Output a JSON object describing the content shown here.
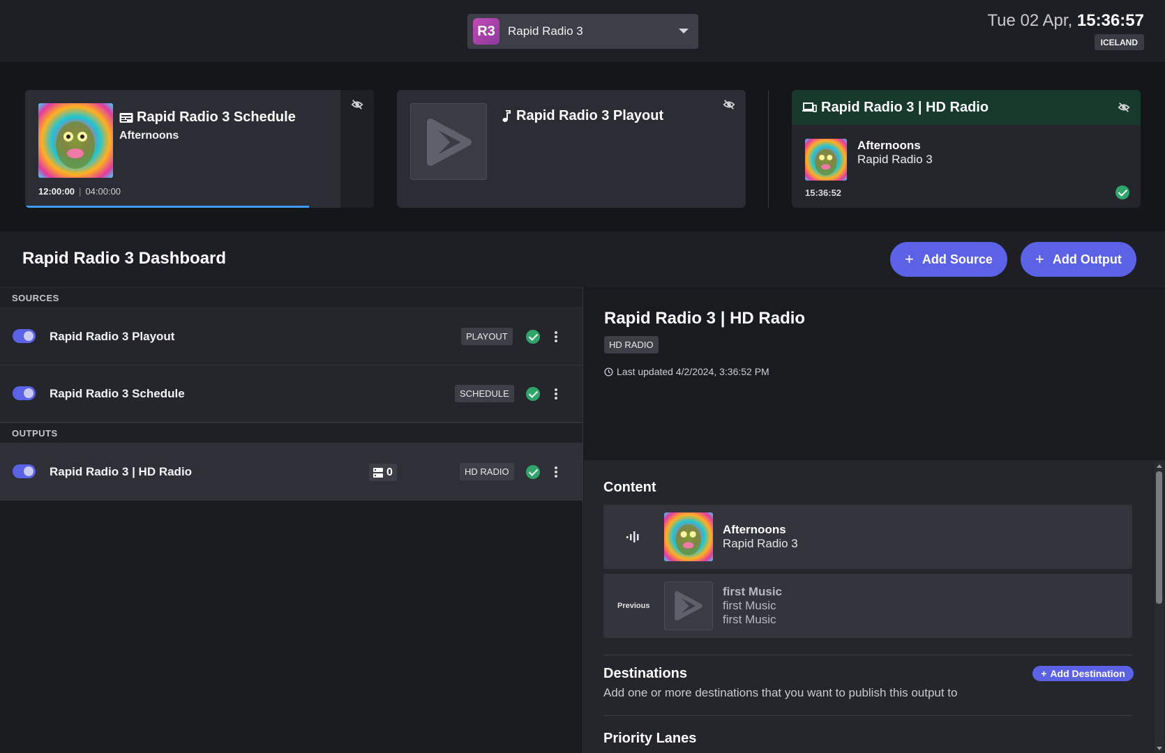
{
  "header": {
    "station_logo": "R3",
    "station_name": "Rapid Radio 3",
    "date": "Tue 02 Apr,",
    "time": "15:36:57",
    "timezone": "ICELAND"
  },
  "cards": {
    "schedule": {
      "title": "Rapid Radio 3 Schedule",
      "subtitle": "Afternoons",
      "start": "12:00:00",
      "separator": "|",
      "duration": "04:00:00",
      "progress": 0.9,
      "icon": "schedule-icon"
    },
    "playout": {
      "title": "Rapid Radio 3 Playout",
      "icon": "music-note-icon"
    },
    "hd_radio": {
      "title": "Rapid Radio 3 | HD Radio",
      "track": "Afternoons",
      "station": "Rapid Radio 3",
      "time": "15:36:52",
      "icon": "devices-icon"
    }
  },
  "dashboard": {
    "title": "Rapid Radio 3 Dashboard",
    "add_source": "Add Source",
    "add_output": "Add Output"
  },
  "sources": {
    "label": "SOURCES",
    "items": [
      {
        "name": "Rapid Radio 3 Playout",
        "type": "PLAYOUT"
      },
      {
        "name": "Rapid Radio 3 Schedule",
        "type": "SCHEDULE"
      }
    ]
  },
  "outputs": {
    "label": "OUTPUTS",
    "items": [
      {
        "name": "Rapid Radio 3 | HD Radio",
        "type": "HD RADIO",
        "count": "0"
      }
    ]
  },
  "detail": {
    "title": "Rapid Radio 3 | HD Radio",
    "badge": "HD RADIO",
    "last_updated": "Last updated 4/2/2024, 3:36:52 PM",
    "content_heading": "Content",
    "current": {
      "title": "Afternoons",
      "artist": "Rapid Radio 3"
    },
    "previous_label": "Previous",
    "previous": {
      "title": "first Music",
      "line2": "first Music",
      "line3": "first Music"
    },
    "destinations_heading": "Destinations",
    "destinations_sub": "Add one or more destinations that you want to publish this output to",
    "add_destination": "Add Destination",
    "priority_heading": "Priority Lanes"
  },
  "colors": {
    "accent": "#5b62e6",
    "ok": "#2fa56b",
    "progress": "#3c9cff",
    "hd_header": "#173a2c"
  }
}
